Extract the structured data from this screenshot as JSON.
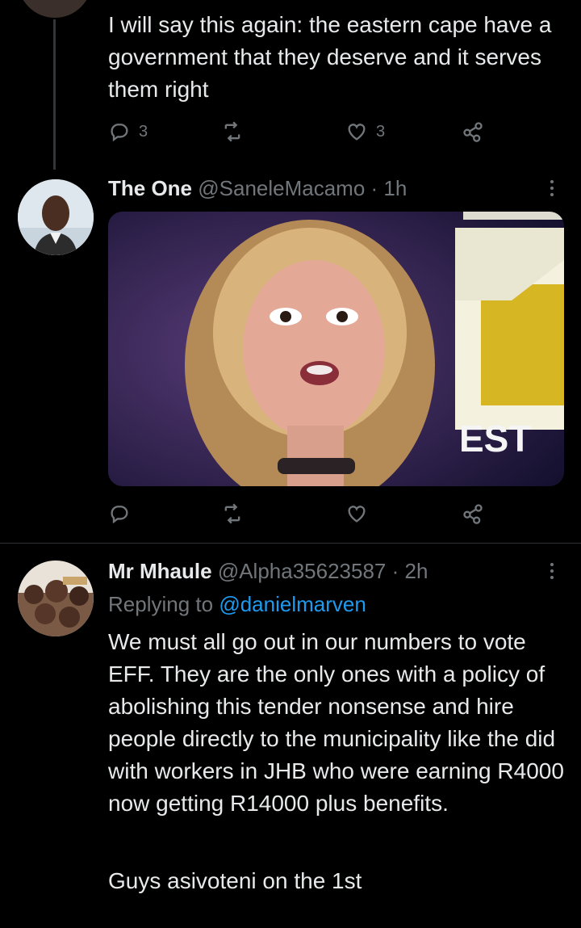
{
  "tweets": [
    {
      "text": "I will say this again: the eastern cape have a government that they deserve and it serves them right",
      "replies": "3",
      "likes": "3"
    },
    {
      "display_name": "The One",
      "handle_time": "@SaneleMacamo · 1h",
      "media_caption": "EST"
    },
    {
      "display_name": "Mr Mhaule",
      "handle_time": "@Alpha35623587 · 2h",
      "replying_prefix": "Replying to ",
      "replying_to": "@danielmarven",
      "text_p1": "We must all go out in our numbers to vote EFF. They are the only ones with a policy of abolishing this tender nonsense and hire people directly to the municipality like the did with workers in JHB who were earning R4000 now getting R14000 plus benefits.",
      "text_p2": "Guys asivoteni on the 1st"
    }
  ],
  "colors": {
    "background": "#000000",
    "text": "#e7e9ea",
    "secondary": "#71767b",
    "link": "#1d9bf0",
    "divider": "#2f3336"
  },
  "icons": [
    "reply-icon",
    "retweet-icon",
    "like-icon",
    "share-icon",
    "more-icon"
  ]
}
